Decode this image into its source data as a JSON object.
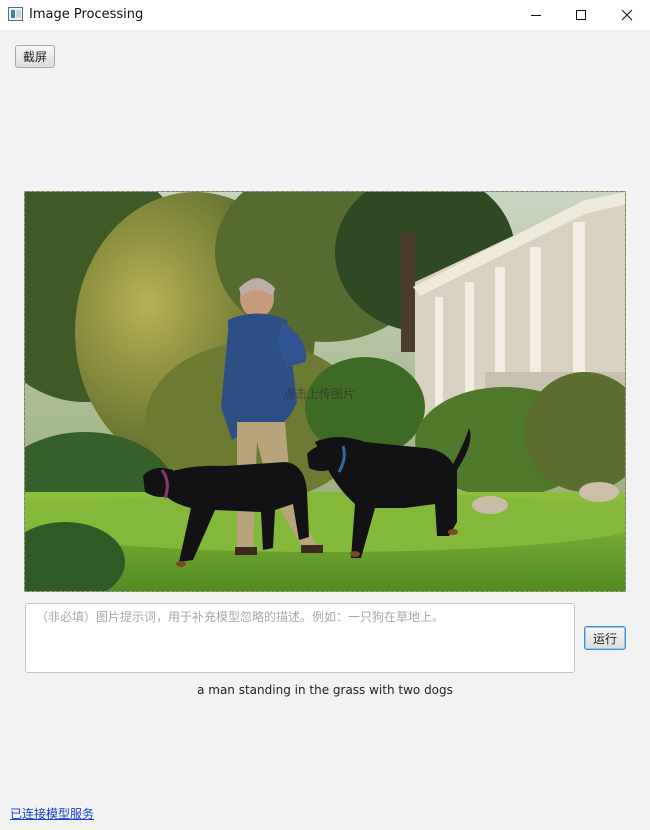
{
  "window": {
    "title": "Image Processing",
    "icon": "app-window-icon",
    "controls": [
      "minimize-icon",
      "maximize-icon",
      "close-icon"
    ]
  },
  "toolbar": {
    "screenshot_label": "截屏"
  },
  "image": {
    "overlay_hint": "点击上传图片",
    "description_visible": "photo of a man on the phone with two black dogs on grass"
  },
  "prompt": {
    "value": "",
    "placeholder": "（非必填）图片提示词，用于补充模型忽略的描述。例如：一只狗在草地上。"
  },
  "actions": {
    "run_label": "运行"
  },
  "result": {
    "caption": "a man standing in the grass with two dogs"
  },
  "status": {
    "link_text": "已连接模型服务"
  },
  "colors": {
    "accent_border": "#3c8ed6",
    "link": "#1a3fd0",
    "background": "#f2f2f2"
  }
}
